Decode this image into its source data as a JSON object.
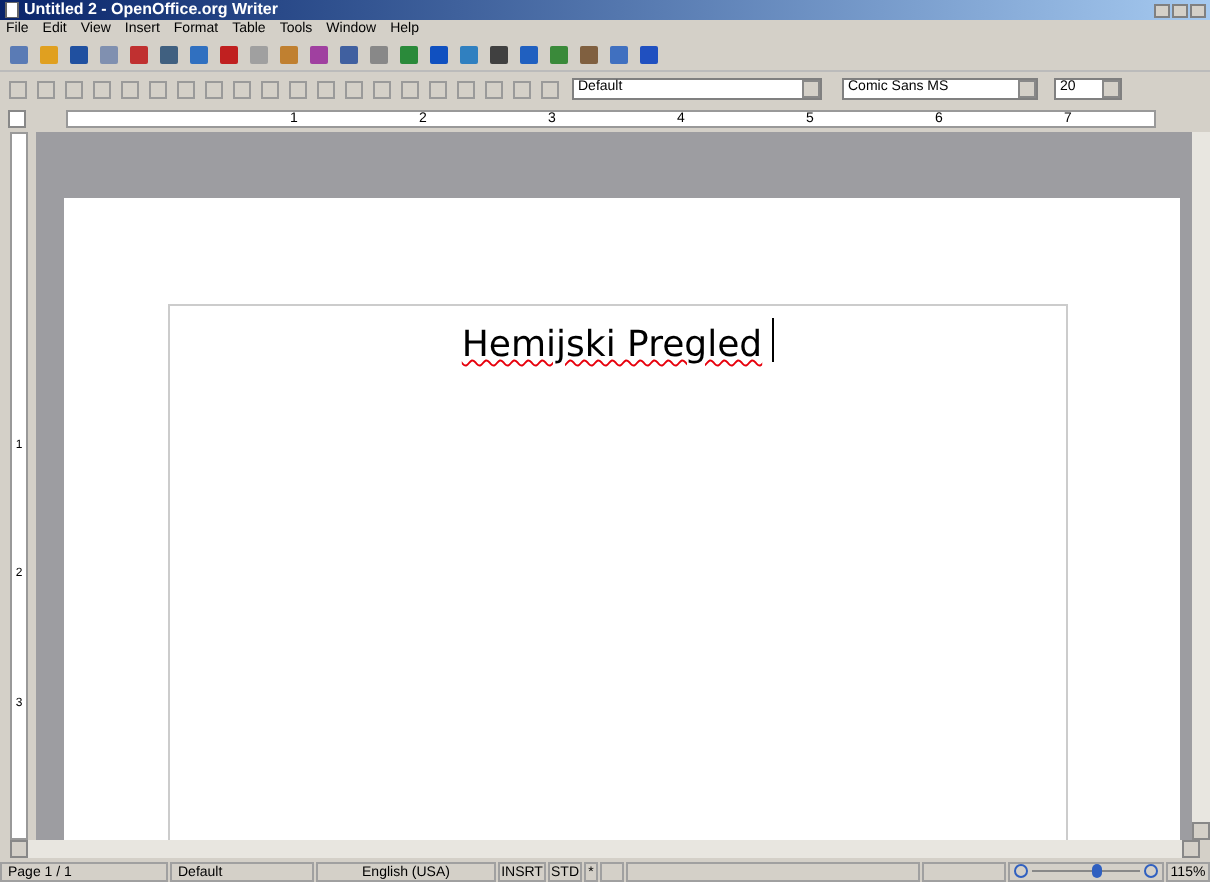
{
  "window": {
    "title": "Untitled 2 - OpenOffice.org Writer"
  },
  "menu": [
    "File",
    "Edit",
    "View",
    "Insert",
    "Format",
    "Table",
    "Tools",
    "Window",
    "Help"
  ],
  "formatting": {
    "style": "Default",
    "font": "Comic Sans MS",
    "size": "20"
  },
  "ruler": {
    "numbers": [
      "1",
      "2",
      "3",
      "4",
      "5",
      "6",
      "7"
    ]
  },
  "vertical_ruler": {
    "numbers": [
      "1",
      "2",
      "3"
    ]
  },
  "document": {
    "text": "Hemijski Pregled"
  },
  "status_bar": {
    "page": "Page 1 / 1",
    "style": "Default",
    "language": "English (USA)",
    "insert_mode": "INSRT",
    "selection_mode": "STD",
    "modified": "*",
    "zoom": "115%",
    "zoom_slider": {
      "level": 0.6
    }
  }
}
